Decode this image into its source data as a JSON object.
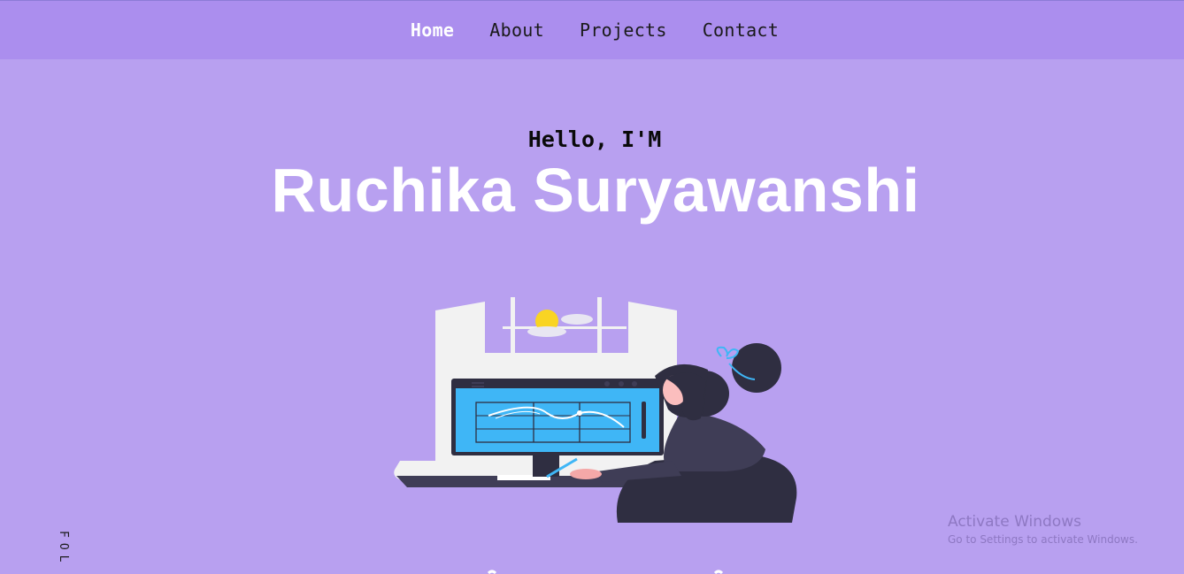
{
  "nav": {
    "items": [
      {
        "label": "Home",
        "active": true
      },
      {
        "label": "About",
        "active": false
      },
      {
        "label": "Projects",
        "active": false
      },
      {
        "label": "Contact",
        "active": false
      }
    ]
  },
  "hero": {
    "greeting": "Hello, I'M",
    "name": "Ruchika Suryawanshi"
  },
  "side": {
    "follow_label": "FOL"
  },
  "watermark": {
    "title": "Activate Windows",
    "subtitle": "Go to Settings to activate Windows."
  },
  "colors": {
    "page_bg": "#b8a0f0",
    "nav_bg": "#ab8eee",
    "name_text": "#ffffff",
    "screen_blue": "#3fb6f6",
    "person_dark": "#2f2e41"
  },
  "icons": {
    "hero_illustration": "person-at-computer-illustration"
  }
}
